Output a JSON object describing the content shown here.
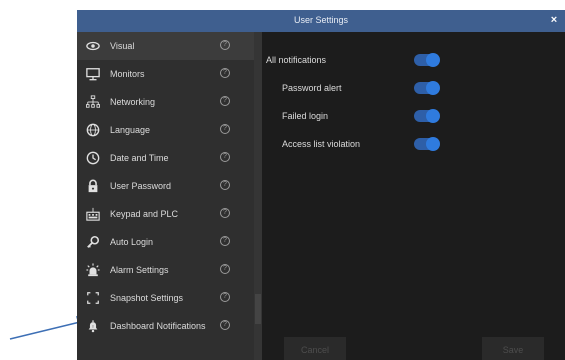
{
  "window": {
    "title": "User Settings",
    "close_glyph": "×"
  },
  "sidebar": {
    "items": [
      {
        "label": "Visual",
        "icon": "eye-icon",
        "active": true
      },
      {
        "label": "Monitors",
        "icon": "monitor-icon"
      },
      {
        "label": "Networking",
        "icon": "network-icon"
      },
      {
        "label": "Language",
        "icon": "globe-icon"
      },
      {
        "label": "Date and Time",
        "icon": "clock-icon"
      },
      {
        "label": "User Password",
        "icon": "lock-icon"
      },
      {
        "label": "Keypad and PLC",
        "icon": "keypad-icon"
      },
      {
        "label": "Auto Login",
        "icon": "key-icon"
      },
      {
        "label": "Alarm Settings",
        "icon": "alarm-icon"
      },
      {
        "label": "Snapshot Settings",
        "icon": "snapshot-icon"
      },
      {
        "label": "Dashboard Notifications",
        "icon": "bell-icon"
      }
    ],
    "help_glyph": "?"
  },
  "notifications": {
    "all_label": "All notifications",
    "items": [
      {
        "label": "Password alert",
        "enabled": true
      },
      {
        "label": "Failed login",
        "enabled": true
      },
      {
        "label": "Access list violation",
        "enabled": true
      }
    ],
    "all_enabled": true
  },
  "buttons": {
    "cancel": "Cancel",
    "save": "Save"
  },
  "colors": {
    "titlebar": "#3f5f8f",
    "toggle_on": "#2f7bde",
    "annotation_arrow": "#3d6fb5"
  }
}
